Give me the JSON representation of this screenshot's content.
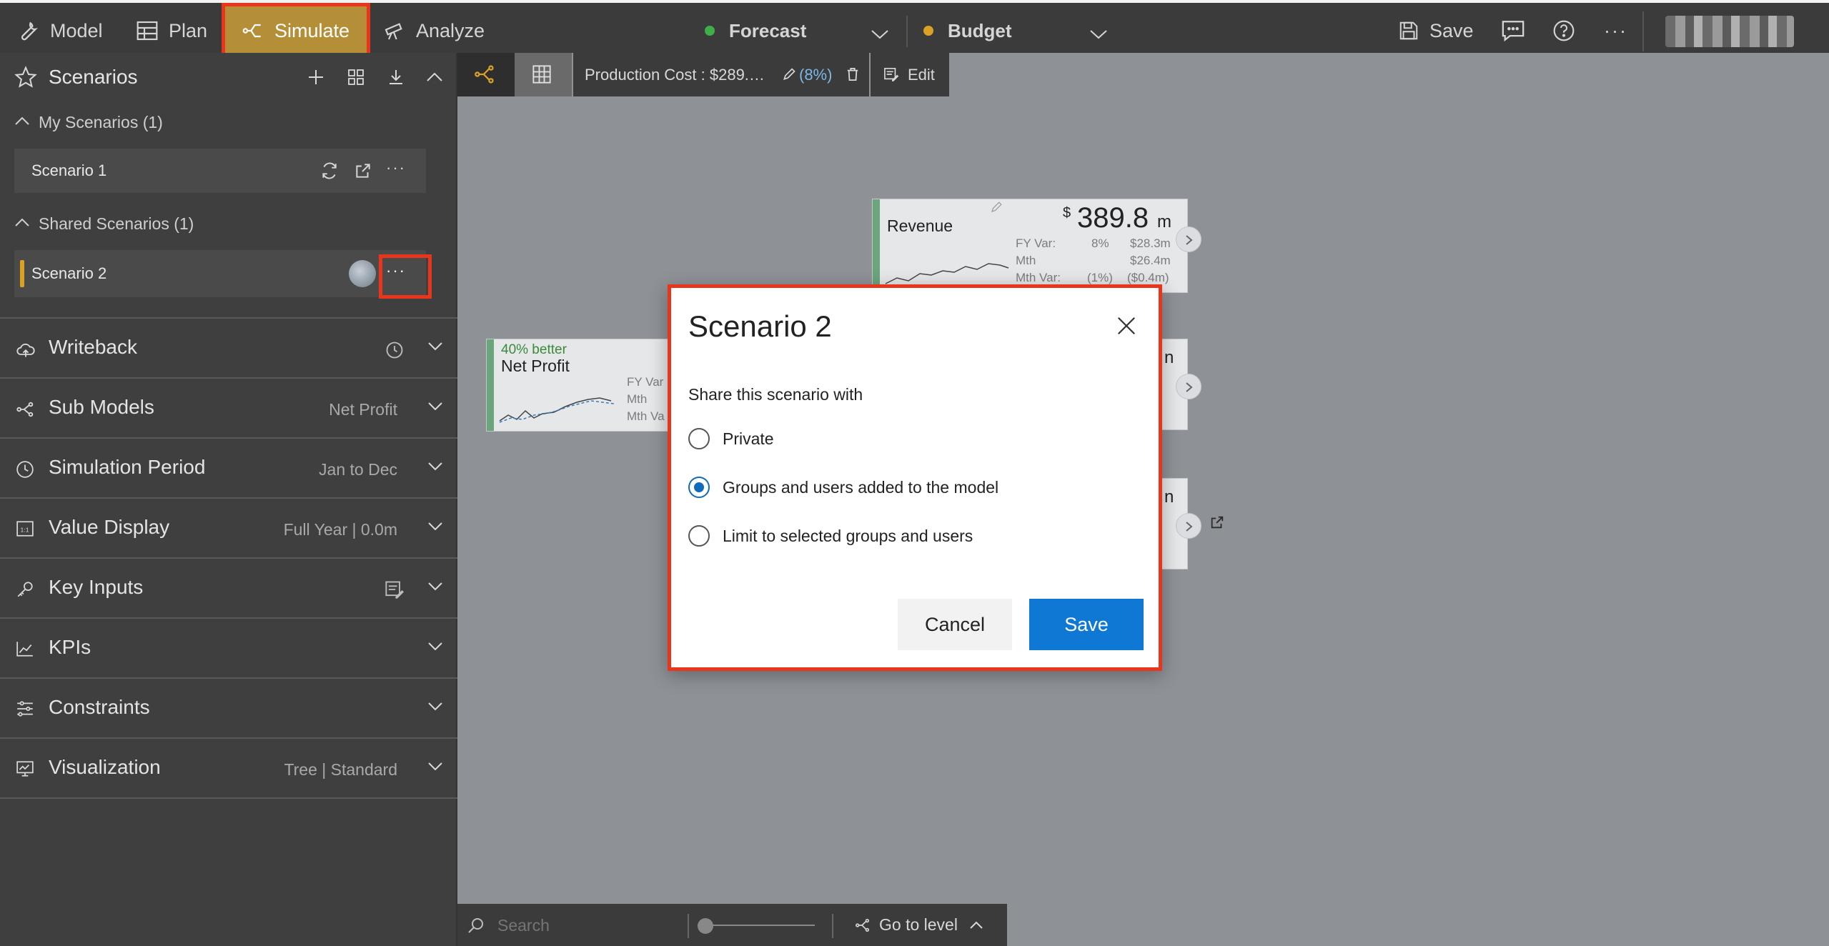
{
  "topbar": {
    "nav": [
      {
        "label": "Model",
        "icon": "wrench-icon"
      },
      {
        "label": "Plan",
        "icon": "table-icon"
      },
      {
        "label": "Simulate",
        "icon": "simulate-icon",
        "active": true
      },
      {
        "label": "Analyze",
        "icon": "telescope-icon"
      }
    ],
    "forecast": {
      "label": "Forecast",
      "dot_color": "#3fae49"
    },
    "budget": {
      "label": "Budget",
      "dot_color": "#d9a227"
    },
    "save_label": "Save",
    "more": "···"
  },
  "sidebar": {
    "title": "Scenarios",
    "my_scenarios": {
      "label": "My Scenarios (1)",
      "items": [
        {
          "name": "Scenario 1"
        }
      ]
    },
    "shared_scenarios": {
      "label": "Shared Scenarios (1)",
      "items": [
        {
          "name": "Scenario 2"
        }
      ]
    },
    "more": "···",
    "sections": [
      {
        "label": "Writeback",
        "value": "",
        "icon": "cloud-icon"
      },
      {
        "label": "Sub Models",
        "value": "Net Profit",
        "icon": "submodel-icon"
      },
      {
        "label": "Simulation Period",
        "value": "Jan to Dec",
        "icon": "clock-icon"
      },
      {
        "label": "Value Display",
        "value": "Full Year | 0.0m",
        "icon": "value-display-icon"
      },
      {
        "label": "Key Inputs",
        "value": "",
        "icon": "key-icon"
      },
      {
        "label": "KPIs",
        "value": "",
        "icon": "kpi-icon"
      },
      {
        "label": "Constraints",
        "value": "",
        "icon": "sliders-icon"
      },
      {
        "label": "Visualization",
        "value": "Tree | Standard",
        "icon": "chart-icon"
      }
    ]
  },
  "canvas": {
    "production_cost": "Production Cost : $289.…",
    "production_pct": "(8%)",
    "edit_label": "Edit",
    "revenue": {
      "title": "Revenue",
      "currency": "$",
      "value": "389.8",
      "unit": "m",
      "rows": [
        {
          "label": "FY Var:",
          "pct": "8%",
          "amt": "$28.3m"
        },
        {
          "label": "Mth",
          "pct": "",
          "amt": "$26.4m"
        },
        {
          "label": "Mth Var:",
          "pct": "(1%)",
          "amt": "($0.4m)"
        }
      ]
    },
    "net_profit": {
      "badge": "40% better",
      "title": "Net Profit",
      "rows": [
        "FY Var",
        "Mth",
        "Mth Va"
      ]
    },
    "partial_letter": "n"
  },
  "bottombar": {
    "search_placeholder": "Search",
    "go_to_level": "Go to level"
  },
  "dialog": {
    "title": "Scenario 2",
    "prompt": "Share this scenario with",
    "options": [
      {
        "label": "Private",
        "selected": false
      },
      {
        "label": "Groups and users added to the model",
        "selected": true
      },
      {
        "label": "Limit to selected groups and users",
        "selected": false
      }
    ],
    "cancel_label": "Cancel",
    "save_label": "Save"
  }
}
